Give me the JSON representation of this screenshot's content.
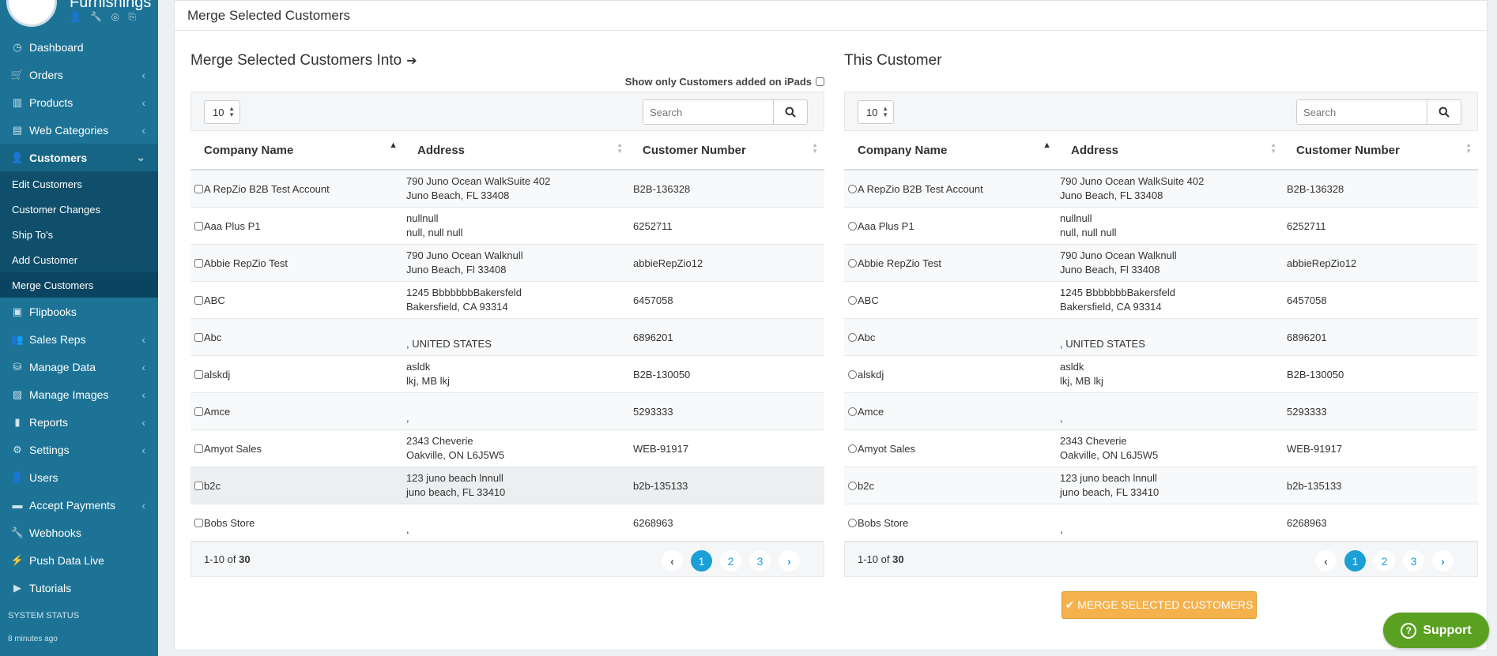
{
  "brand": {
    "name": "Furnishings",
    "icons": "👤 🔧 ◎ ⎘"
  },
  "sidebar": {
    "items": [
      {
        "label": "Dashboard",
        "icon": "◷",
        "chevron": false
      },
      {
        "label": "Orders",
        "icon": "🛒",
        "chevron": true
      },
      {
        "label": "Products",
        "icon": "▥",
        "chevron": true
      },
      {
        "label": "Web Categories",
        "icon": "▤",
        "chevron": true
      },
      {
        "label": "Customers",
        "icon": "👤",
        "chevron": true,
        "active": true
      },
      {
        "label": "Flipbooks",
        "icon": "▣",
        "chevron": false
      },
      {
        "label": "Sales Reps",
        "icon": "👥",
        "chevron": true
      },
      {
        "label": "Manage Data",
        "icon": "⛁",
        "chevron": true
      },
      {
        "label": "Manage Images",
        "icon": "▨",
        "chevron": true
      },
      {
        "label": "Reports",
        "icon": "▮",
        "chevron": true
      },
      {
        "label": "Settings",
        "icon": "⚙",
        "chevron": true
      },
      {
        "label": "Users",
        "icon": "👤",
        "chevron": false
      },
      {
        "label": "Accept Payments",
        "icon": "▬",
        "chevron": true
      },
      {
        "label": "Webhooks",
        "icon": "🔧",
        "chevron": false
      },
      {
        "label": "Push Data Live",
        "icon": "⚡",
        "chevron": false
      },
      {
        "label": "Tutorials",
        "icon": "▶",
        "chevron": false
      }
    ],
    "customer_sub": [
      "Edit Customers",
      "Customer Changes",
      "Ship To's",
      "Add Customer",
      "Merge Customers"
    ],
    "system_status": "SYSTEM STATUS",
    "status_time": "8 minutes ago"
  },
  "header": {
    "title": "Merge Selected Customers"
  },
  "left_panel": {
    "title": "Merge Selected Customers Into",
    "ipad_label": "Show only Customers added on iPads",
    "length": "10",
    "search_placeholder": "Search"
  },
  "right_panel": {
    "title": "This Customer",
    "length": "10",
    "search_placeholder": "Search"
  },
  "columns": [
    "Company Name",
    "Address",
    "Customer Number"
  ],
  "rows": [
    {
      "name": "A RepZio B2B Test Account",
      "addr1": "790 Juno Ocean WalkSuite 402",
      "addr2": "Juno Beach, FL 33408",
      "num": "B2B-136328"
    },
    {
      "name": "Aaa Plus P1",
      "addr1": "nullnull",
      "addr2": "null, null null",
      "num": "6252711"
    },
    {
      "name": "Abbie RepZio Test",
      "addr1": "790 Juno Ocean Walknull",
      "addr2": "Juno Beach, Fl 33408",
      "num": "abbieRepZio12"
    },
    {
      "name": "ABC",
      "addr1": "1245 BbbbbbbBakersfeld",
      "addr2": "Bakersfield, CA 93314",
      "num": "6457058"
    },
    {
      "name": "Abc",
      "addr1": "",
      "addr2": ", UNITED STATES",
      "num": "6896201"
    },
    {
      "name": "alskdj",
      "addr1": "asldk",
      "addr2": "lkj, MB lkj",
      "num": "B2B-130050"
    },
    {
      "name": "Amce",
      "addr1": "",
      "addr2": ",",
      "num": "5293333"
    },
    {
      "name": "Amyot Sales",
      "addr1": "2343 Cheverie",
      "addr2": "Oakville, ON L6J5W5",
      "num": "WEB-91917"
    },
    {
      "name": "b2c",
      "addr1": "123 juno beach lnnull",
      "addr2": "juno beach, FL 33410",
      "num": "b2b-135133"
    },
    {
      "name": "Bobs Store",
      "addr1": "",
      "addr2": ",",
      "num": "6268963"
    }
  ],
  "pagination": {
    "range": "1-10",
    "of_label": "of",
    "total": "30",
    "pages": [
      "1",
      "2",
      "3"
    ],
    "prev": "‹",
    "next": "›"
  },
  "merge_button": {
    "label": "✔ MERGE SELECTED CUSTOMERS"
  },
  "support_button": {
    "label": "Support",
    "icon": "?"
  },
  "colors": {
    "sidebar": "#1c7396",
    "accent": "#1a9fd6",
    "merge": "#f4b14c",
    "support": "#5aa021"
  }
}
